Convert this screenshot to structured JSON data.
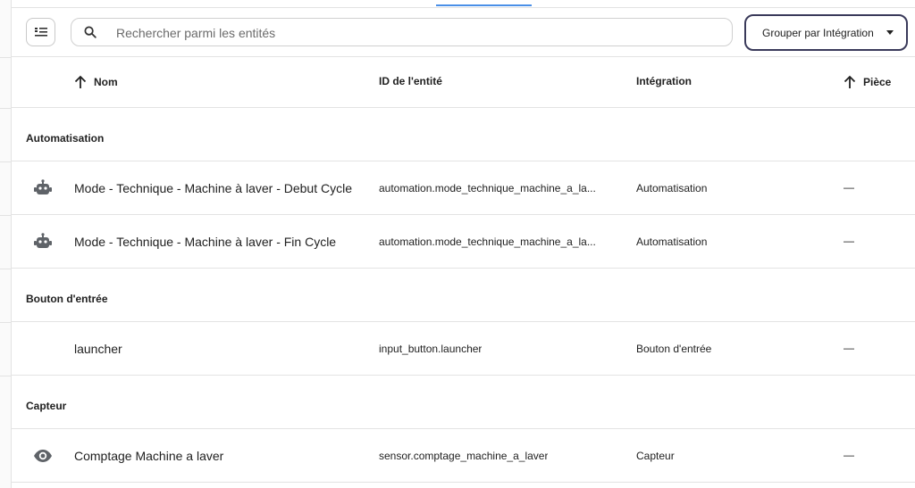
{
  "toolbar": {
    "search_placeholder": "Rechercher parmi les entités",
    "group_by_label": "Grouper par Intégration"
  },
  "table": {
    "columns": {
      "name": "Nom",
      "entity_id": "ID de l'entité",
      "integration": "Intégration",
      "room": "Pièce"
    },
    "groups": [
      {
        "label": "Automatisation",
        "rows": [
          {
            "icon": "robot-icon",
            "name": "Mode - Technique - Machine à laver - Debut Cycle",
            "entity_id": "automation.mode_technique_machine_a_la...",
            "integration": "Automatisation",
            "room": "—"
          },
          {
            "icon": "robot-icon",
            "name": "Mode - Technique - Machine à laver - Fin Cycle",
            "entity_id": "automation.mode_technique_machine_a_la...",
            "integration": "Automatisation",
            "room": "—"
          }
        ]
      },
      {
        "label": "Bouton d'entrée",
        "rows": [
          {
            "icon": "",
            "name": "launcher",
            "entity_id": "input_button.launcher",
            "integration": "Bouton d'entrée",
            "room": "—"
          }
        ]
      },
      {
        "label": "Capteur",
        "rows": [
          {
            "icon": "eye-icon",
            "name": "Comptage Machine a laver",
            "entity_id": "sensor.comptage_machine_a_laver",
            "integration": "Capteur",
            "room": "—"
          }
        ]
      }
    ]
  }
}
